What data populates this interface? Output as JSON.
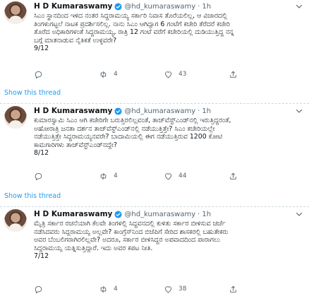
{
  "tweets": [
    {
      "name": "H D Kumaraswamy",
      "handle": "@hd_kumaraswamy",
      "dot": "·",
      "time": "1h",
      "lines": [
        "ಸಿಎಂ ಸ್ಥಾನದಿಂದ ಇಳಿದ ನಂತರ ಸಿದ್ದರಾಮಯ್ಯ ಸರ್ಕಾರಿ ನಿವಾಸ ತೊರೆಯಲಿಲ್ಲ, ಆ ವಿಚಾರದಲ್ಲಿ",
        "ತಿಂಗಳುಗಟ್ಟಲೆ ನಾಟಕ ಪ್ರದರ್ಶಿಸಲಿಲ್ಲ. ನಾನು ಸಿಎಂ ಆಗಿದ್ದಾಗ 6 ಗಂಟೆಗೆ ಕಚೇರಿ ತೆರೆದರೆ ಕಚೇರಿ",
        "ತೊರೆದ ಅಧಿಕಾರಿಗಳಂತೆ ಸಿದ್ದರಾಮಯ್ಯ, ರಾತ್ರಿ 12 ಗಂಟೆ ವರೆಗೆ ಕಚೇರಿಯಲ್ಲಿ ದುಡಿಯುತ್ತಿದ್ದ ನನ್ನ",
        "ಬಗ್ಗೆ ಮಾತನಾಡುವ ನೈತಿಕತೆ ಉಳ್ಳವರೇ?",
        "9/12"
      ],
      "replies": "",
      "retweets": "4",
      "likes": "43"
    },
    {
      "name": "H D Kumaraswamy",
      "handle": "@hd_kumaraswamy",
      "dot": "·",
      "time": "1h",
      "lines": [
        "ಕುಮಾರಸ್ವಾಮಿ ಸಿಎಂ ಆಗಿ ಕಚೇರಿಗೇ ಬರುತ್ತಿರಲಿಲ್ಲವಂತೆ, ತಾಜ್‌ವೆಸ್ಟ್‌ಎಂಡ್‌ನಲ್ಲಿ ಇರುತ್ತಿದ್ದರಂತೆ,",
        "ಅಹೋರಾತ್ರಿ ಜನತಾ ದರ್ಶನ ತಾಜ್‌ವೆಸ್ಟ್‌ಎಂಡ್‌ನಲ್ಲಿ ನಡೆಯುತ್ತಿತ್ತೇ? ಸಿಎಂ ಕಚೇರಿಯಲ್ಲೇ",
        "ನಡೆಯುತ್ತಿತ್ತೇ ಸಿದ್ದರಾಮಯ್ಯನವರೇ? ಬಾದಾಮಿಯಲ್ಲಿ ಈಗ ನಡೆಯುತ್ತಿರುವ 1200 ಕೋಟಿ",
        "ಕಾಮಗಾರಿಗಳು ತಾಜ್‌ವೆಸ್ಟ್‌ಎಂಡ್‌ನದ್ದೇ?",
        "8/12"
      ],
      "replies": "",
      "retweets": "4",
      "likes": "44"
    },
    {
      "name": "H D Kumaraswamy",
      "handle": "@hd_kumaraswamy",
      "dot": "·",
      "time": "1h",
      "lines": [
        "ಮೈತ್ರಿ ಸರ್ಕಾರ ರಚನೆಯಾಗಿ ಕೆಲವೇ ತಿಂಗಳಲ್ಲಿ ಸಿದ್ದವನದಲ್ಲಿ ಕುಳಿತು ಸರ್ಕಾರ ಬೀಳಿಸುವ ಚರ್ಚೆ",
        "ನಡೆಸಿದವರು ಸಿದ್ದರಾಮಯ್ಯ ಅಲ್ಲವೇ? ಕಾಂಗ್ರೆಸ್‌ನಿಂದ ಬಿಜೆಪಿಗೆ ಸೇರಿದ ಶಾಸಕರಲ್ಲಿ ಬಹುತೇಕರು",
        "ಅವರ ಬೆಂಬಲಿಗರಾಗಿರಲಿಲ್ಲವೇ? ಅದರೂ, ಸರ್ಕಾರ ಬೀಳಿಸಿದ್ದರ ಅಪವಾದದಿಂದ ಪಾರಾಗಲು",
        "ಸಿದ್ದರಾಮಯ್ಯ ಯತ್ನಿಸುತ್ತಿದ್ದಾರೆ. ಇದು ಅವರ ಕಪಟ ನೀತಿ.",
        "7/12"
      ],
      "replies": "",
      "retweets": "4",
      "likes": "38"
    }
  ],
  "show_thread_label": "Show this thread",
  "colors": {
    "accent": "#1d9bf0",
    "muted": "#536471",
    "text": "#0f1419"
  }
}
